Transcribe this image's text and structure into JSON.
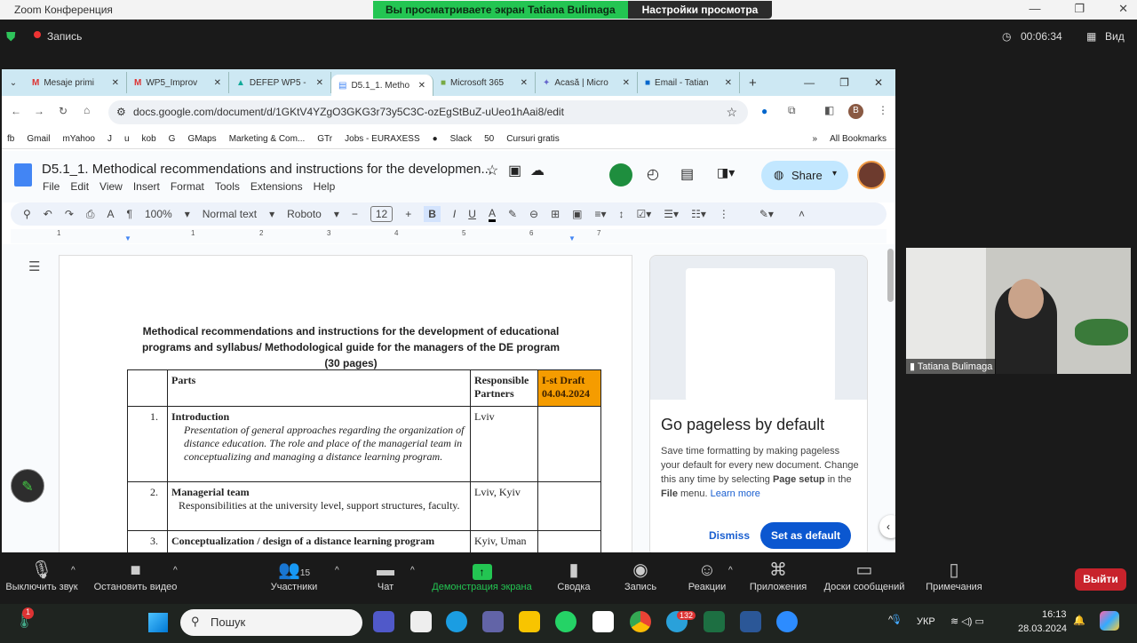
{
  "zoom": {
    "window_title": "Zoom Конференция",
    "banner_viewing": "Вы просматриваете экран Tatiana Bulimaga",
    "banner_settings": "Настройки просмотра",
    "recording": "Запись",
    "timer": "00:06:34",
    "view": "Вид"
  },
  "browser": {
    "tabs": [
      {
        "label": "Mesaje primi",
        "icon": "gmail"
      },
      {
        "label": "WP5_Improv",
        "icon": "gmail"
      },
      {
        "label": "DEFEP WP5 -",
        "icon": "drive"
      },
      {
        "label": "D5.1_1. Metho",
        "icon": "docs",
        "active": true
      },
      {
        "label": "Microsoft 365",
        "icon": "ms365"
      },
      {
        "label": "Acasă | Micro",
        "icon": "copilot"
      },
      {
        "label": "Email - Tatian",
        "icon": "outlook"
      }
    ],
    "url": "docs.google.com/document/d/1GKtV4YZgO3GKG3r73y5C3C-ozEgStBuZ-uUeo1hAai8/edit",
    "profile_initial": "B",
    "bookmarks": [
      "fb",
      "Gmail",
      "mYahoo",
      "J",
      "u",
      "kob",
      "G",
      "GMaps",
      "Marketing & Com...",
      "GTr",
      "Jobs - EURAXESS",
      "",
      "Slack",
      "50",
      "Cursuri gratis"
    ],
    "all_bookmarks": "All Bookmarks"
  },
  "docs": {
    "title": "D5.1_1. Methodical recommendations and instructions for the developmen...",
    "menus": [
      "File",
      "Edit",
      "View",
      "Insert",
      "Format",
      "Tools",
      "Extensions",
      "Help"
    ],
    "share": "Share",
    "toolbar": {
      "zoom": "100%",
      "style": "Normal text",
      "font": "Roboto",
      "size": "12"
    },
    "ruler": [
      "1",
      "1",
      "2",
      "3",
      "4",
      "5",
      "6",
      "7"
    ],
    "heading": [
      "Methodical recommendations and instructions for the development of educational",
      "programs and syllabus/ Methodological guide for the managers of the DE program",
      "(30 pages)"
    ],
    "table": {
      "headers": {
        "parts": "Parts",
        "responsible": "Responsible Partners",
        "draft": "I-st Draft 04.04.2024"
      },
      "rows": [
        {
          "num": "1.",
          "title": "Introduction",
          "desc": "Presentation of general approaches regarding the organization of distance education. The role and place of the managerial team in conceptualizing and managing a distance learning program.",
          "partners": "Lviv"
        },
        {
          "num": "2.",
          "title": "Managerial team",
          "desc": "Responsibilities at the university level, support structures, faculty.",
          "partners": "Lviv, Kyiv"
        },
        {
          "num": "3.",
          "title": "Conceptualization / design of a distance learning program",
          "desc": "",
          "partners": "Kyiv, Uman"
        }
      ]
    },
    "promo": {
      "title": "Go pageless by default",
      "text_1": "Save time formatting by making pageless your default for every new document. Change this any time by selecting ",
      "bold_1": "Page setup",
      "text_2": " in the ",
      "bold_2": "File",
      "text_3": " menu. ",
      "learn_more": "Learn more",
      "dismiss": "Dismiss",
      "set_default": "Set as default"
    }
  },
  "participant": {
    "name": "Tatiana Bulimaga"
  },
  "controls": [
    {
      "label": "Выключить звук",
      "icon": "mic"
    },
    {
      "label": "Остановить видео",
      "icon": "video"
    },
    {
      "label": "Участники",
      "icon": "participants",
      "count": "15"
    },
    {
      "label": "Чат",
      "icon": "chat"
    },
    {
      "label": "Демонстрация экрана",
      "icon": "share-screen"
    },
    {
      "label": "Сводка",
      "icon": "summary"
    },
    {
      "label": "Запись",
      "icon": "record"
    },
    {
      "label": "Реакции",
      "icon": "reactions"
    },
    {
      "label": "Приложения",
      "icon": "apps"
    },
    {
      "label": "Доски сообщений",
      "icon": "whiteboard"
    },
    {
      "label": "Примечания",
      "icon": "notes"
    }
  ],
  "leave": "Выйти",
  "taskbar": {
    "search": "Пошук",
    "lang": "УКР",
    "time": "16:13",
    "date": "28.03.2024",
    "weather_badge": "1",
    "telegram_badge": "132"
  },
  "colors": {
    "share_green": "#23c552",
    "leave_red": "#c8232c",
    "draft_header": "#f59c00",
    "docs_blue": "#0b57d0"
  }
}
